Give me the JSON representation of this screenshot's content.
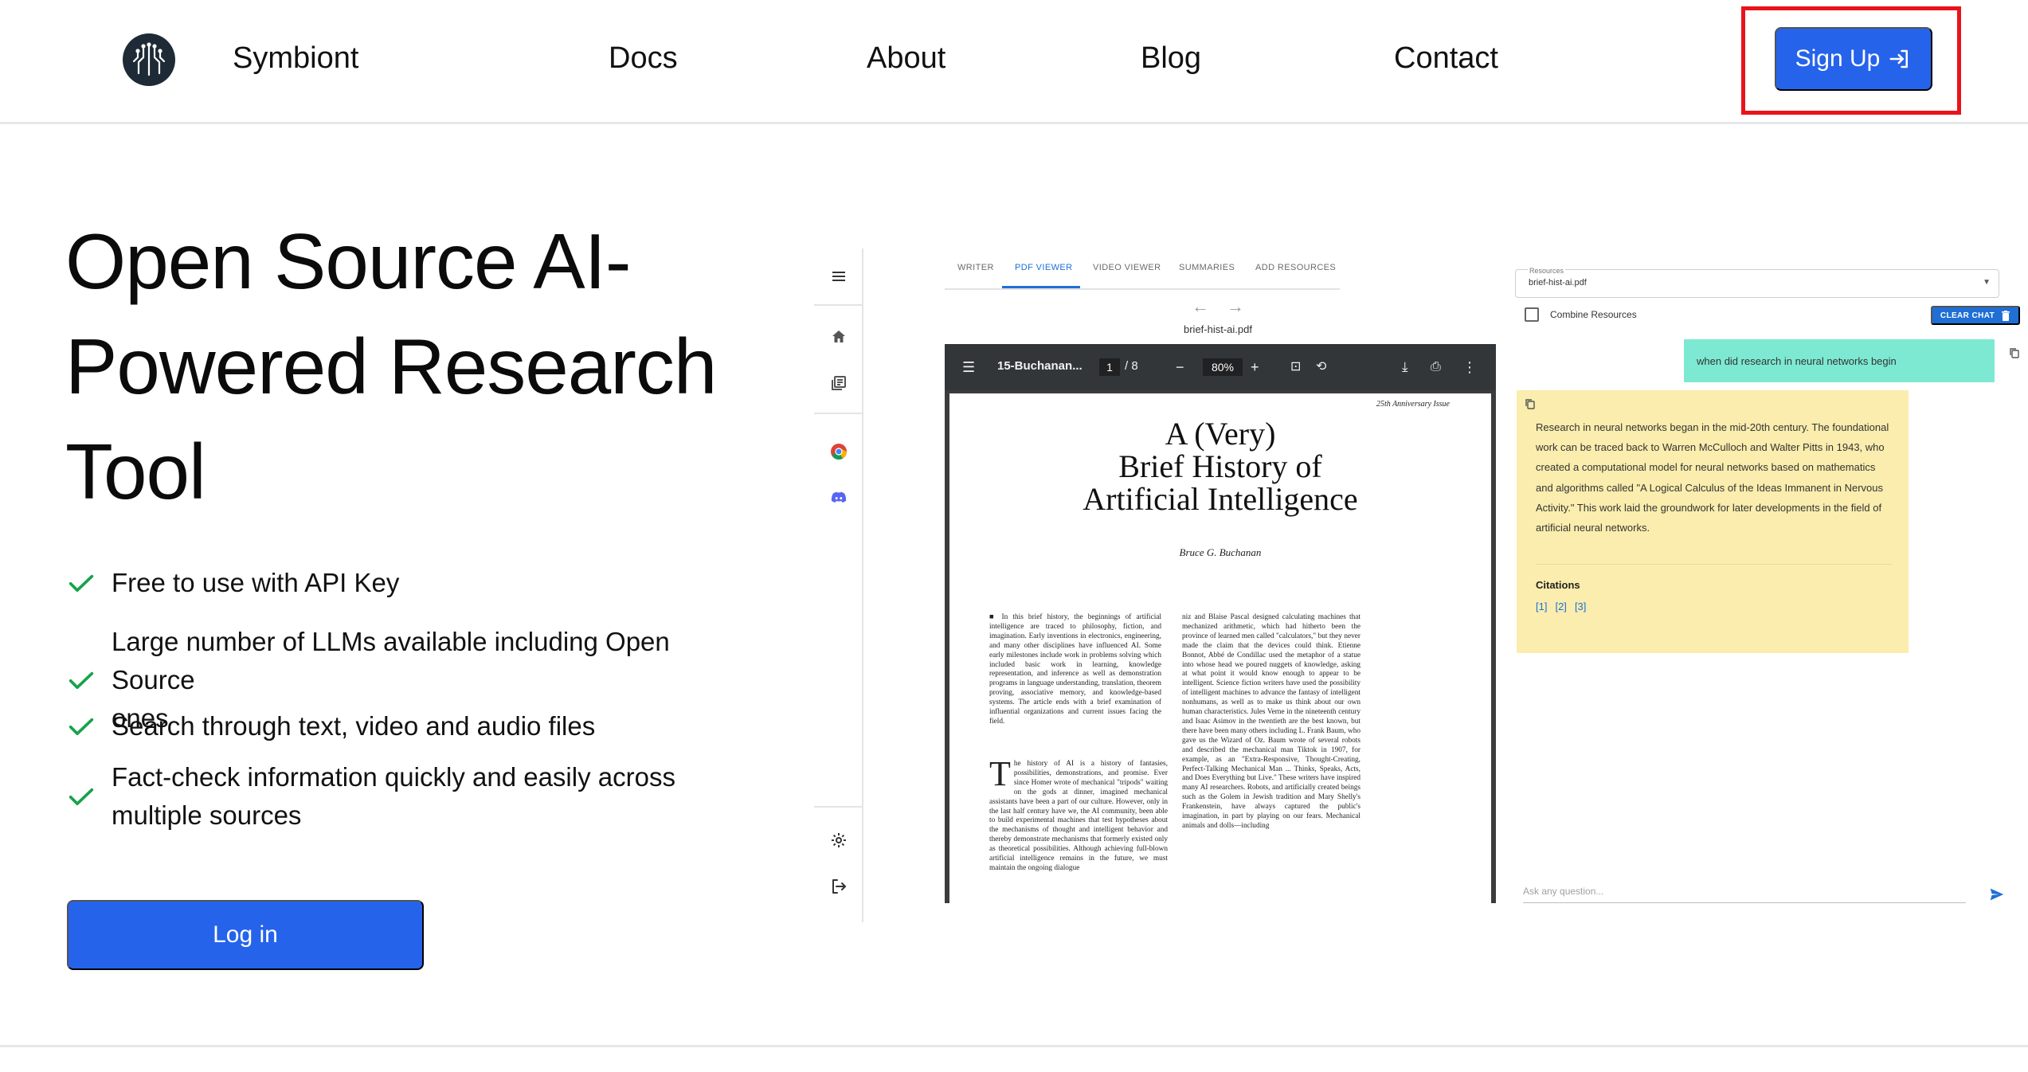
{
  "nav": {
    "brand": "Symbiont",
    "links": [
      "Docs",
      "About",
      "Blog",
      "Contact"
    ],
    "signup_label": "Sign Up"
  },
  "hero": {
    "title_lines": [
      "Open Source AI-",
      "Powered Research",
      "Tool"
    ],
    "features": [
      [
        "Free to use with API Key"
      ],
      [
        "Large number of LLMs available including Open Source",
        "ones"
      ],
      [
        "Search through text, video and audio files"
      ],
      [
        "Fact-check information quickly and easily across",
        "multiple sources"
      ]
    ],
    "login_label": "Log in"
  },
  "app": {
    "tabs": [
      "WRITER",
      "PDF VIEWER",
      "VIDEO VIEWER",
      "SUMMARIES",
      "ADD RESOURCES"
    ],
    "active_tab": "PDF VIEWER",
    "pdf_file": "brief-hist-ai.pdf",
    "viewer": {
      "doc_name": "15-Buchanan...",
      "page": "1",
      "total": "/ 8",
      "zoom": "80%"
    },
    "page": {
      "issue": "25th Anniversary Issue",
      "title_lines": [
        "A (Very)",
        "Brief History of",
        "Artificial Intelligence"
      ],
      "author": "Bruce G. Buchanan",
      "abstract": "■ In this brief history, the beginnings of artificial intelligence are traced to philosophy, fiction, and imagination. Early inventions in electronics, engineering, and many other disciplines have influenced AI. Some early milestones include work in problems solving which included basic work in learning, knowledge representation, and inference as well as demonstration programs in language understanding, translation, theorem proving, associative memory, and knowledge-based systems. The article ends with a brief examination of influential organizations and current issues facing the field.",
      "col1_dropcap": "T",
      "col1": "he history of AI is a history of fantasies, possibilities, demonstrations, and promise. Ever since Homer wrote of mechanical \"tripods\" waiting on the gods at dinner, imagined mechanical assistants have been a part of our culture. However, only in the last half century have we, the AI community, been able to build experimental machines that test hypotheses about the mechanisms of thought and intelligent behavior and thereby demonstrate mechanisms that formerly existed only as theoretical possibilities. Although achieving full-blown artificial intelligence remains in the future, we must maintain the ongoing dialogue",
      "col2": "niz and Blaise Pascal designed calculating machines that mechanized arithmetic, which had hitherto been the province of learned men called \"calculators,\" but they never made the claim that the devices could think. Etienne Bonnot, Abbé de Condillac used the metaphor of a statue into whose head we poured nuggets of knowledge, asking at what point it would know enough to appear to be intelligent. Science fiction writers have used the possibility of intelligent machines to advance the fantasy of intelligent nonhumans, as well as to make us think about our own human characteristics. Jules Verne in the nineteenth century and Isaac Asimov in the twentieth are the best known, but there have been many others including L. Frank Baum, who gave us the Wizard of Oz. Baum wrote of several robots and described the mechanical man Tiktok in 1907, for example, as an \"Extra-Responsive, Thought-Creating, Perfect-Talking Mechanical Man ... Thinks, Speaks, Acts, and Does Everything but Live.\" These writers have inspired many AI researchers. Robots, and artificially created beings such as the Golem in Jewish tradition and Mary Shelly's Frankenstein, have always captured the public's imagination, in part by playing on our fears. Mechanical animals and dolls—including"
    },
    "chat": {
      "resources_label": "Resources",
      "resource_value": "brief-hist-ai.pdf",
      "combine_label": "Combine Resources",
      "clear_label": "CLEAR CHAT",
      "user_message": "when did research in neural networks begin",
      "ai_message": "Research in neural networks began in the mid-20th century. The foundational work can be traced back to Warren McCulloch and Walter Pitts in 1943, who created a computational model for neural networks based on mathematics and algorithms called \"A Logical Calculus of the Ideas Immanent in Nervous Activity.\" This work laid the groundwork for later developments in the field of artificial neural networks.",
      "citations_label": "Citations",
      "citations": [
        "[1]",
        "[2]",
        "[3]"
      ],
      "ask_placeholder": "Ask any question..."
    }
  },
  "colors": {
    "primary": "#2563eb",
    "highlight_frame": "#e8141b",
    "check": "#16a34a",
    "user_bubble": "#7de9d2",
    "ai_bubble": "#faedad",
    "tab_active": "#1f6fd6"
  },
  "icons": {
    "logo": "circuit-brain-logo",
    "signup": "login-arrow-icon",
    "feature": "check-icon",
    "rail": [
      "menu-icon",
      "home-icon",
      "library-icon",
      "chrome-icon",
      "discord-icon",
      "settings-icon",
      "logout-icon"
    ]
  }
}
